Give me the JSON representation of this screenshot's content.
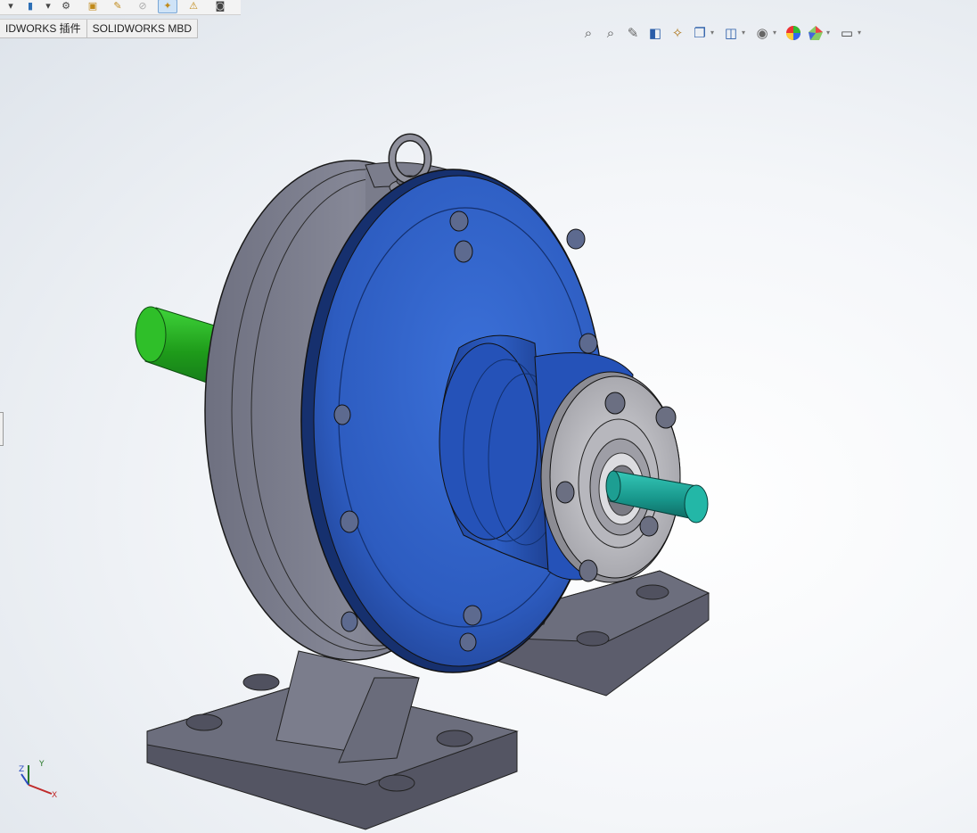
{
  "toolbar": {
    "icons": [
      "dropdown-caret",
      "feature-icon",
      "dropdown-caret",
      "assembly-icon",
      "component-icon",
      "mate-icon",
      "pattern-icon",
      "smart-fastener-icon",
      "tools-icon",
      "camera-icon"
    ],
    "active_icon": "smart-fastener-icon"
  },
  "tabs": [
    {
      "label": "IDWORKS 插件"
    },
    {
      "label": "SOLIDWORKS MBD"
    }
  ],
  "view_toolbar": {
    "icons": [
      "zoom-to-fit-icon",
      "zoom-to-area-icon",
      "previous-view-icon",
      "section-view-icon",
      "dynamic-annotation-icon",
      "view-orientation-icon",
      "display-style-icon",
      "hide-show-items-icon",
      "edit-appearance-icon",
      "apply-scene-icon",
      "view-settings-icon"
    ]
  },
  "triad": {
    "x_label": "X",
    "y_label": "Y",
    "z_label": "Z"
  },
  "colors": {
    "housing_gray": "#7b7d8c",
    "cover_blue": "#2f5fc4",
    "input_shaft_green": "#22a41c",
    "output_shaft_teal": "#1aa091",
    "bearing_cap_silver": "#c4c4c8",
    "base_gray": "#5f6070"
  }
}
